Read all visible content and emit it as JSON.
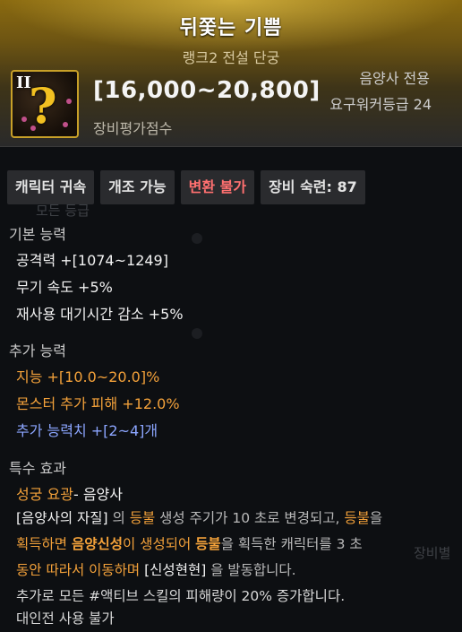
{
  "header": {
    "title": "뒤쫓는 기쁨",
    "rank": "랭크2 전설 단궁",
    "icon_roman": "II",
    "icon_glyph": "?",
    "score": "[16,000~20,800]",
    "score_label": "장비평가점수",
    "class_only": "음양사 전용",
    "required_level": "요구워커등급 24"
  },
  "badges": {
    "bound": "캐릭터 귀속",
    "modifiable": "개조 가능",
    "transform": "변환 불가",
    "proficiency": "장비 숙련: 87"
  },
  "basic": {
    "heading": "기본 능력",
    "attack": "공격력  +[1074~1249]",
    "weapon_speed": "무기 속도 +5%",
    "cooldown": "재사용 대기시간 감소 +5%"
  },
  "extra": {
    "heading": "추가 능력",
    "int": "지능  +[10.0~20.0]%",
    "monster_damage": "몬스터 추가 피해  +12.0%",
    "extra_stats": "추가 능력치 +[2~4]개"
  },
  "special": {
    "heading": "특수 효과",
    "name": "성궁 요광",
    "class_suffix": "- 음양사",
    "p1_a": "[음양사의 자질]",
    "p1_b": " 의 ",
    "p1_c": "등불",
    "p1_d": " 생성 주기가 10 초로 변경되고, ",
    "p1_e": "등불",
    "p1_f": "을",
    "p2_a": "획득하면 ",
    "p2_b": "음양신성",
    "p2_c": "이 생성되어 ",
    "p2_d": "등불",
    "p2_e": "을 획득한 캐릭터를 3 초",
    "p3_a": "동안 따라서 이동하며 ",
    "p3_b": "[신성현현]",
    "p3_c": " 을 발동합니다.",
    "p4": "추가로 모든 #액티브 스킬의 피해량이 20% 증가합니다.",
    "pvp": "대인전 사용 불가"
  },
  "background_ghost": {
    "a": "모든 등급",
    "b": "장비별"
  },
  "colors": {
    "accent_gold": "#f2c021",
    "orange": "#f3a13a",
    "blue": "#8ca6ff",
    "red": "#ff7070"
  }
}
